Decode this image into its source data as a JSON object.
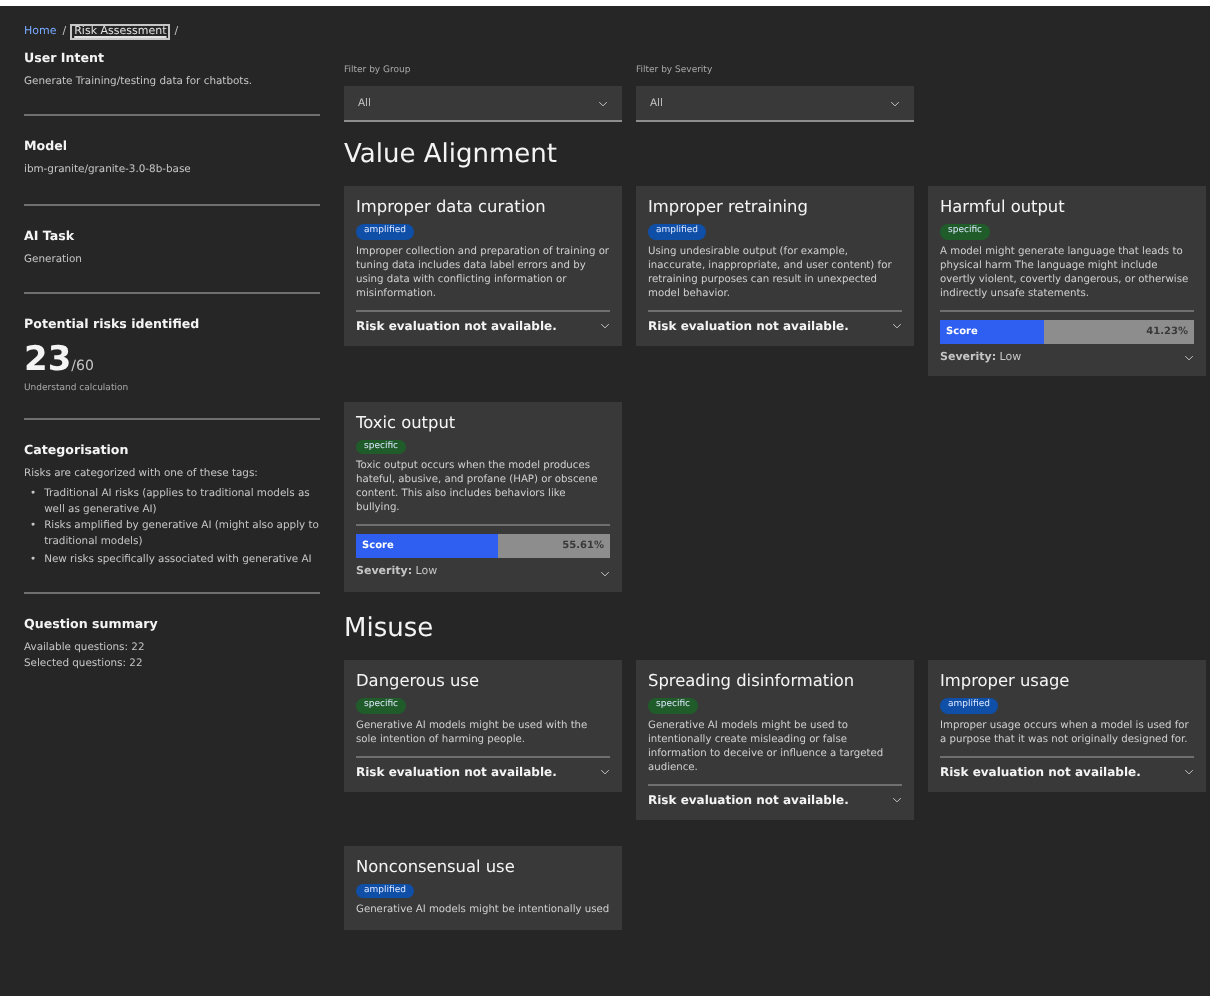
{
  "breadcrumb": {
    "home": "Home",
    "current": "Risk Assessment",
    "separator": "/"
  },
  "sidebar": {
    "sections": [
      {
        "title": "User Intent",
        "lines": [
          "Generate Training/testing data for chatbots."
        ]
      },
      {
        "title": "Model",
        "lines": [
          "ibm-granite/granite-3.0-8b-base"
        ]
      },
      {
        "title": "AI Task",
        "lines": [
          "Generation"
        ]
      }
    ],
    "risks": {
      "title": "Potential risks identified",
      "count": "23",
      "total": "/60",
      "link": "Understand calculation"
    },
    "categorisation": {
      "title": "Categorisation",
      "intro": "Risks are categorized with one of these tags:",
      "bullet": "•",
      "items": [
        "Traditional AI risks (applies to traditional models as well as generative AI)",
        "Risks amplified by generative AI (might also apply to traditional models)",
        "New risks specifically associated with generative AI"
      ]
    },
    "summary": {
      "title": "Question summary",
      "lines": [
        "Available questions: 22",
        "Selected questions: 22"
      ]
    }
  },
  "filters": [
    {
      "label": "Filter by Group",
      "value": "All"
    },
    {
      "label": "Filter by Severity",
      "value": "All"
    }
  ],
  "groups": [
    {
      "title": "Value Alignment",
      "cards": [
        {
          "title": "Improper data curation",
          "tag": {
            "label": "amplified",
            "color": "#0f4fa8"
          },
          "description": "Improper collection and preparation of training or tuning data includes data label errors and by using data with conflicting information or misinformation.",
          "kind": "unavailable",
          "status": "Risk evaluation not available."
        },
        {
          "title": "Improper retraining",
          "tag": {
            "label": "amplified",
            "color": "#0f4fa8"
          },
          "description": "Using undesirable output (for example, inaccurate, inappropriate, and user content) for retraining purposes can result in unexpected model behavior.",
          "kind": "unavailable",
          "status": "Risk evaluation not available."
        },
        {
          "title": "Harmful output",
          "tag": {
            "label": "specific",
            "color": "#1f5c2a"
          },
          "description": "A model might generate language that leads to physical harm The language might include overtly violent, covertly dangerous, or otherwise indirectly unsafe statements.",
          "kind": "score",
          "score_label": "Score",
          "level": 0.4123,
          "reading": "41.23%",
          "severity": "**Severity:** Low"
        },
        {
          "title": "Toxic output",
          "tag": {
            "label": "specific",
            "color": "#1f5c2a"
          },
          "description": "Toxic output occurs when the model produces hateful, abusive, and profane (HAP) or obscene content. This also includes behaviors like bullying.",
          "kind": "score",
          "score_label": "Score",
          "level": 0.5561,
          "reading": "55.61%",
          "severity": "**Severity:** Low"
        }
      ]
    },
    {
      "title": "Misuse",
      "cards": [
        {
          "title": "Dangerous use",
          "tag": {
            "label": "specific",
            "color": "#1f5c2a"
          },
          "description": "Generative AI models might be used with the sole intention of harming people.",
          "kind": "unavailable",
          "status": "Risk evaluation not available."
        },
        {
          "title": "Spreading disinformation",
          "tag": {
            "label": "specific",
            "color": "#1f5c2a"
          },
          "description": "Generative AI models might be used to intentionally create misleading or false information to deceive or influence a targeted audience.",
          "kind": "unavailable",
          "status": "Risk evaluation not available."
        },
        {
          "title": "Improper usage",
          "tag": {
            "label": "amplified",
            "color": "#0f4fa8"
          },
          "description": "Improper usage occurs when a model is used for a purpose that it was not originally designed for.",
          "kind": "unavailable",
          "status": "Risk evaluation not available."
        },
        {
          "title": "Nonconsensual use",
          "tag": {
            "label": "amplified",
            "color": "#0f4fa8"
          },
          "description": "Generative AI models might be intentionally used",
          "kind": "none"
        }
      ]
    }
  ]
}
